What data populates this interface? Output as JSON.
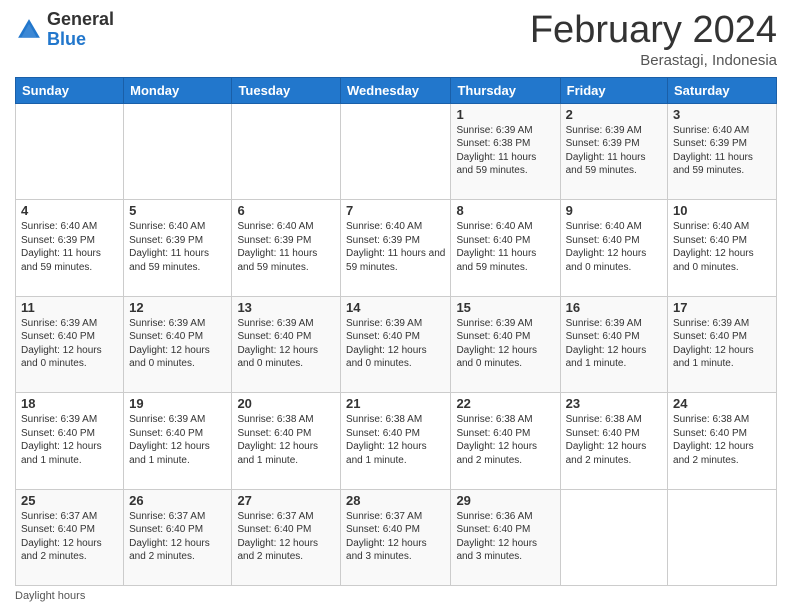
{
  "logo": {
    "general": "General",
    "blue": "Blue"
  },
  "title": "February 2024",
  "subtitle": "Berastagi, Indonesia",
  "days_of_week": [
    "Sunday",
    "Monday",
    "Tuesday",
    "Wednesday",
    "Thursday",
    "Friday",
    "Saturday"
  ],
  "footer_text": "Daylight hours",
  "weeks": [
    [
      {
        "day": "",
        "info": ""
      },
      {
        "day": "",
        "info": ""
      },
      {
        "day": "",
        "info": ""
      },
      {
        "day": "",
        "info": ""
      },
      {
        "day": "1",
        "info": "Sunrise: 6:39 AM\nSunset: 6:38 PM\nDaylight: 11 hours and 59 minutes."
      },
      {
        "day": "2",
        "info": "Sunrise: 6:39 AM\nSunset: 6:39 PM\nDaylight: 11 hours and 59 minutes."
      },
      {
        "day": "3",
        "info": "Sunrise: 6:40 AM\nSunset: 6:39 PM\nDaylight: 11 hours and 59 minutes."
      }
    ],
    [
      {
        "day": "4",
        "info": "Sunrise: 6:40 AM\nSunset: 6:39 PM\nDaylight: 11 hours and 59 minutes."
      },
      {
        "day": "5",
        "info": "Sunrise: 6:40 AM\nSunset: 6:39 PM\nDaylight: 11 hours and 59 minutes."
      },
      {
        "day": "6",
        "info": "Sunrise: 6:40 AM\nSunset: 6:39 PM\nDaylight: 11 hours and 59 minutes."
      },
      {
        "day": "7",
        "info": "Sunrise: 6:40 AM\nSunset: 6:39 PM\nDaylight: 11 hours and 59 minutes."
      },
      {
        "day": "8",
        "info": "Sunrise: 6:40 AM\nSunset: 6:40 PM\nDaylight: 11 hours and 59 minutes."
      },
      {
        "day": "9",
        "info": "Sunrise: 6:40 AM\nSunset: 6:40 PM\nDaylight: 12 hours and 0 minutes."
      },
      {
        "day": "10",
        "info": "Sunrise: 6:40 AM\nSunset: 6:40 PM\nDaylight: 12 hours and 0 minutes."
      }
    ],
    [
      {
        "day": "11",
        "info": "Sunrise: 6:39 AM\nSunset: 6:40 PM\nDaylight: 12 hours and 0 minutes."
      },
      {
        "day": "12",
        "info": "Sunrise: 6:39 AM\nSunset: 6:40 PM\nDaylight: 12 hours and 0 minutes."
      },
      {
        "day": "13",
        "info": "Sunrise: 6:39 AM\nSunset: 6:40 PM\nDaylight: 12 hours and 0 minutes."
      },
      {
        "day": "14",
        "info": "Sunrise: 6:39 AM\nSunset: 6:40 PM\nDaylight: 12 hours and 0 minutes."
      },
      {
        "day": "15",
        "info": "Sunrise: 6:39 AM\nSunset: 6:40 PM\nDaylight: 12 hours and 0 minutes."
      },
      {
        "day": "16",
        "info": "Sunrise: 6:39 AM\nSunset: 6:40 PM\nDaylight: 12 hours and 1 minute."
      },
      {
        "day": "17",
        "info": "Sunrise: 6:39 AM\nSunset: 6:40 PM\nDaylight: 12 hours and 1 minute."
      }
    ],
    [
      {
        "day": "18",
        "info": "Sunrise: 6:39 AM\nSunset: 6:40 PM\nDaylight: 12 hours and 1 minute."
      },
      {
        "day": "19",
        "info": "Sunrise: 6:39 AM\nSunset: 6:40 PM\nDaylight: 12 hours and 1 minute."
      },
      {
        "day": "20",
        "info": "Sunrise: 6:38 AM\nSunset: 6:40 PM\nDaylight: 12 hours and 1 minute."
      },
      {
        "day": "21",
        "info": "Sunrise: 6:38 AM\nSunset: 6:40 PM\nDaylight: 12 hours and 1 minute."
      },
      {
        "day": "22",
        "info": "Sunrise: 6:38 AM\nSunset: 6:40 PM\nDaylight: 12 hours and 2 minutes."
      },
      {
        "day": "23",
        "info": "Sunrise: 6:38 AM\nSunset: 6:40 PM\nDaylight: 12 hours and 2 minutes."
      },
      {
        "day": "24",
        "info": "Sunrise: 6:38 AM\nSunset: 6:40 PM\nDaylight: 12 hours and 2 minutes."
      }
    ],
    [
      {
        "day": "25",
        "info": "Sunrise: 6:37 AM\nSunset: 6:40 PM\nDaylight: 12 hours and 2 minutes."
      },
      {
        "day": "26",
        "info": "Sunrise: 6:37 AM\nSunset: 6:40 PM\nDaylight: 12 hours and 2 minutes."
      },
      {
        "day": "27",
        "info": "Sunrise: 6:37 AM\nSunset: 6:40 PM\nDaylight: 12 hours and 2 minutes."
      },
      {
        "day": "28",
        "info": "Sunrise: 6:37 AM\nSunset: 6:40 PM\nDaylight: 12 hours and 3 minutes."
      },
      {
        "day": "29",
        "info": "Sunrise: 6:36 AM\nSunset: 6:40 PM\nDaylight: 12 hours and 3 minutes."
      },
      {
        "day": "",
        "info": ""
      },
      {
        "day": "",
        "info": ""
      }
    ]
  ]
}
